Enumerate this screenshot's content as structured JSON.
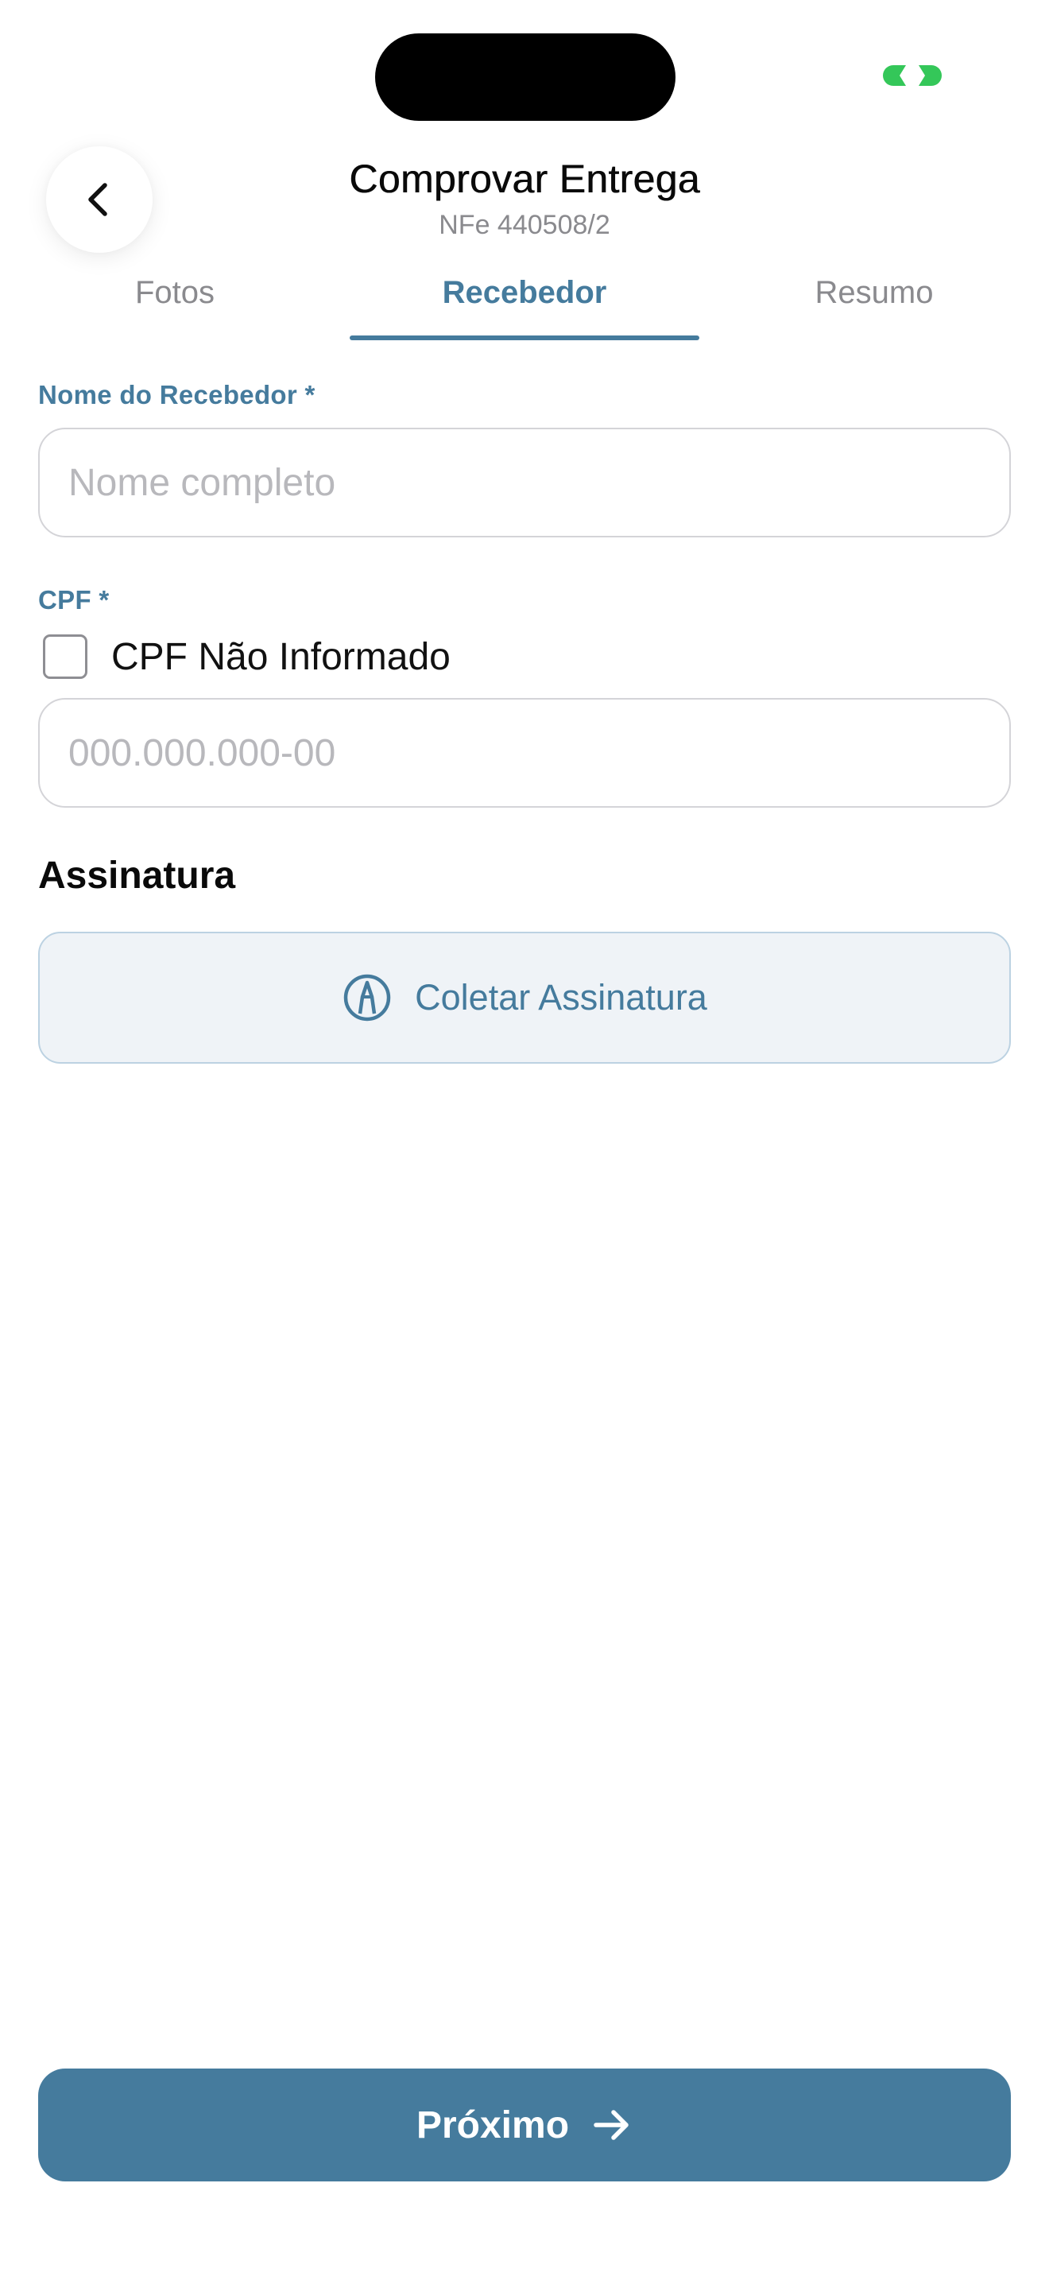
{
  "header": {
    "title": "Comprovar Entrega",
    "subtitle": "NFe 440508/2",
    "back_icon": "chevron-left-icon"
  },
  "status_bar": {
    "indicator_icon": "link-icon",
    "indicator_color": "#34c759"
  },
  "tabs": [
    {
      "label": "Fotos",
      "active": false
    },
    {
      "label": "Recebedor",
      "active": true
    },
    {
      "label": "Resumo",
      "active": false
    }
  ],
  "form": {
    "name": {
      "label": "Nome do Recebedor *",
      "value": "",
      "placeholder": "Nome completo"
    },
    "cpf": {
      "label": "CPF *",
      "not_informed_label": "CPF Não Informado",
      "not_informed_checked": false,
      "value": "",
      "placeholder": "000.000.000-00"
    },
    "signature": {
      "section_title": "Assinatura",
      "button_label": "Coletar Assinatura",
      "button_icon": "pen-tip-icon"
    }
  },
  "footer": {
    "next_label": "Próximo",
    "next_icon": "arrow-right-icon"
  },
  "colors": {
    "accent": "#457b9d",
    "text": "#111111",
    "muted": "#8a8a8e",
    "placeholder": "#b8b8bc",
    "signature_bg": "#eff3f7"
  }
}
